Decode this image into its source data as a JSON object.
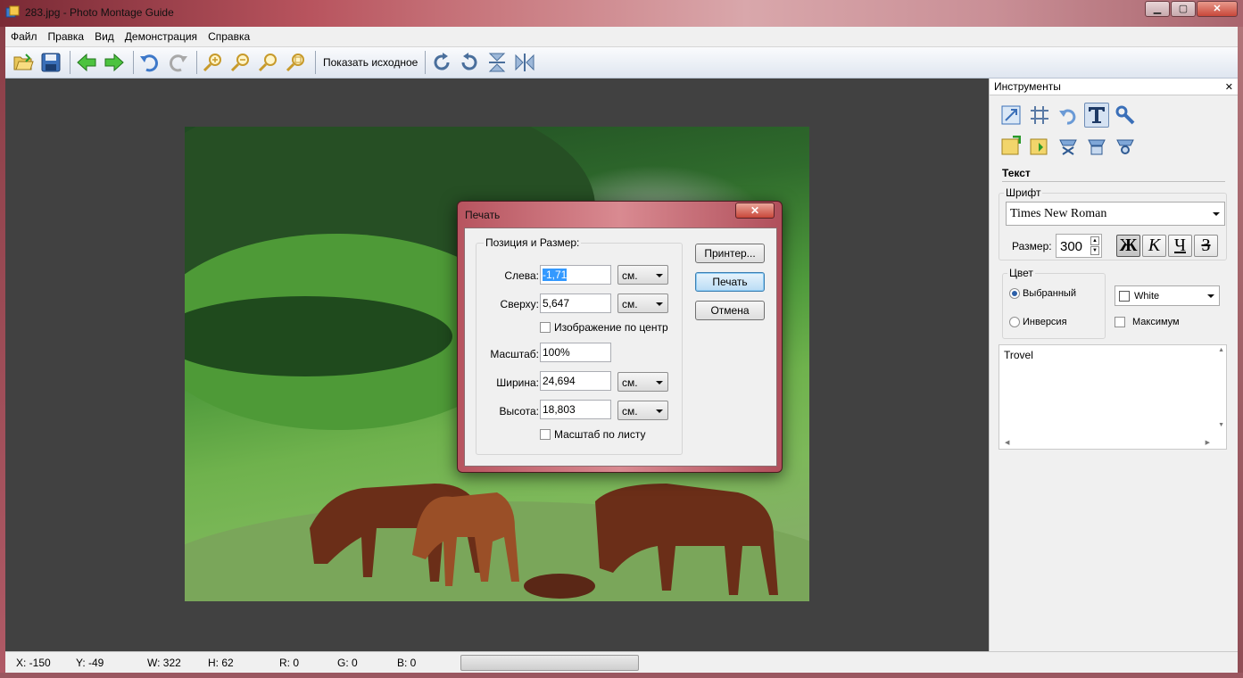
{
  "window": {
    "title": "283.jpg - Photo Montage Guide",
    "min": "▁",
    "max": "▢",
    "close": "✕"
  },
  "menu": [
    "Файл",
    "Правка",
    "Вид",
    "Демонстрация",
    "Справка"
  ],
  "toolbar": {
    "show_original_label": "Показать исходное",
    "icons": [
      "open-icon",
      "save-icon",
      "back-icon",
      "forward-icon",
      "undo-icon",
      "redo-icon",
      "zoom-in-icon",
      "zoom-out-icon",
      "zoom-fit-icon",
      "zoom-actual-icon",
      "rotate-cw-icon",
      "rotate-ccw-icon",
      "flip-vertical-icon",
      "flip-horizontal-icon"
    ]
  },
  "panel": {
    "title": "Инструменты",
    "close": "✕",
    "section": "Текст",
    "font_group": "Шрифт",
    "font_value": "Times New Roman",
    "size_label": "Размер:",
    "size_value": "300",
    "format_buttons": {
      "bold": "Ж",
      "italic": "К",
      "underline": "Ч",
      "strike": "З"
    },
    "color_group": "Цвет",
    "radio_selected": "Выбранный",
    "radio_inverse": "Инверсия",
    "color_value": "White",
    "max_label": "Максимум",
    "text_value": "Trovel"
  },
  "dialog": {
    "title": "Печать",
    "close": "✕",
    "group_label": "Позиция и Размер:",
    "left_label": "Слева:",
    "left_value": "-1,71",
    "top_label": "Сверху:",
    "top_value": "5,647",
    "unit": "см.",
    "center_label": "Изображение по центр",
    "scale_label": "Масштаб:",
    "scale_value": "100%",
    "width_label": "Ширина:",
    "width_value": "24,694",
    "height_label": "Высота:",
    "height_value": "18,803",
    "fit_label": "Масштаб по листу",
    "printer_button": "Принтер...",
    "print_button": "Печать",
    "cancel_button": "Отмена"
  },
  "status": {
    "x": "X: -150",
    "y": "Y: -49",
    "w": "W: 322",
    "h": "H: 62",
    "r": "R: 0",
    "g": "G: 0",
    "b": "B: 0"
  }
}
